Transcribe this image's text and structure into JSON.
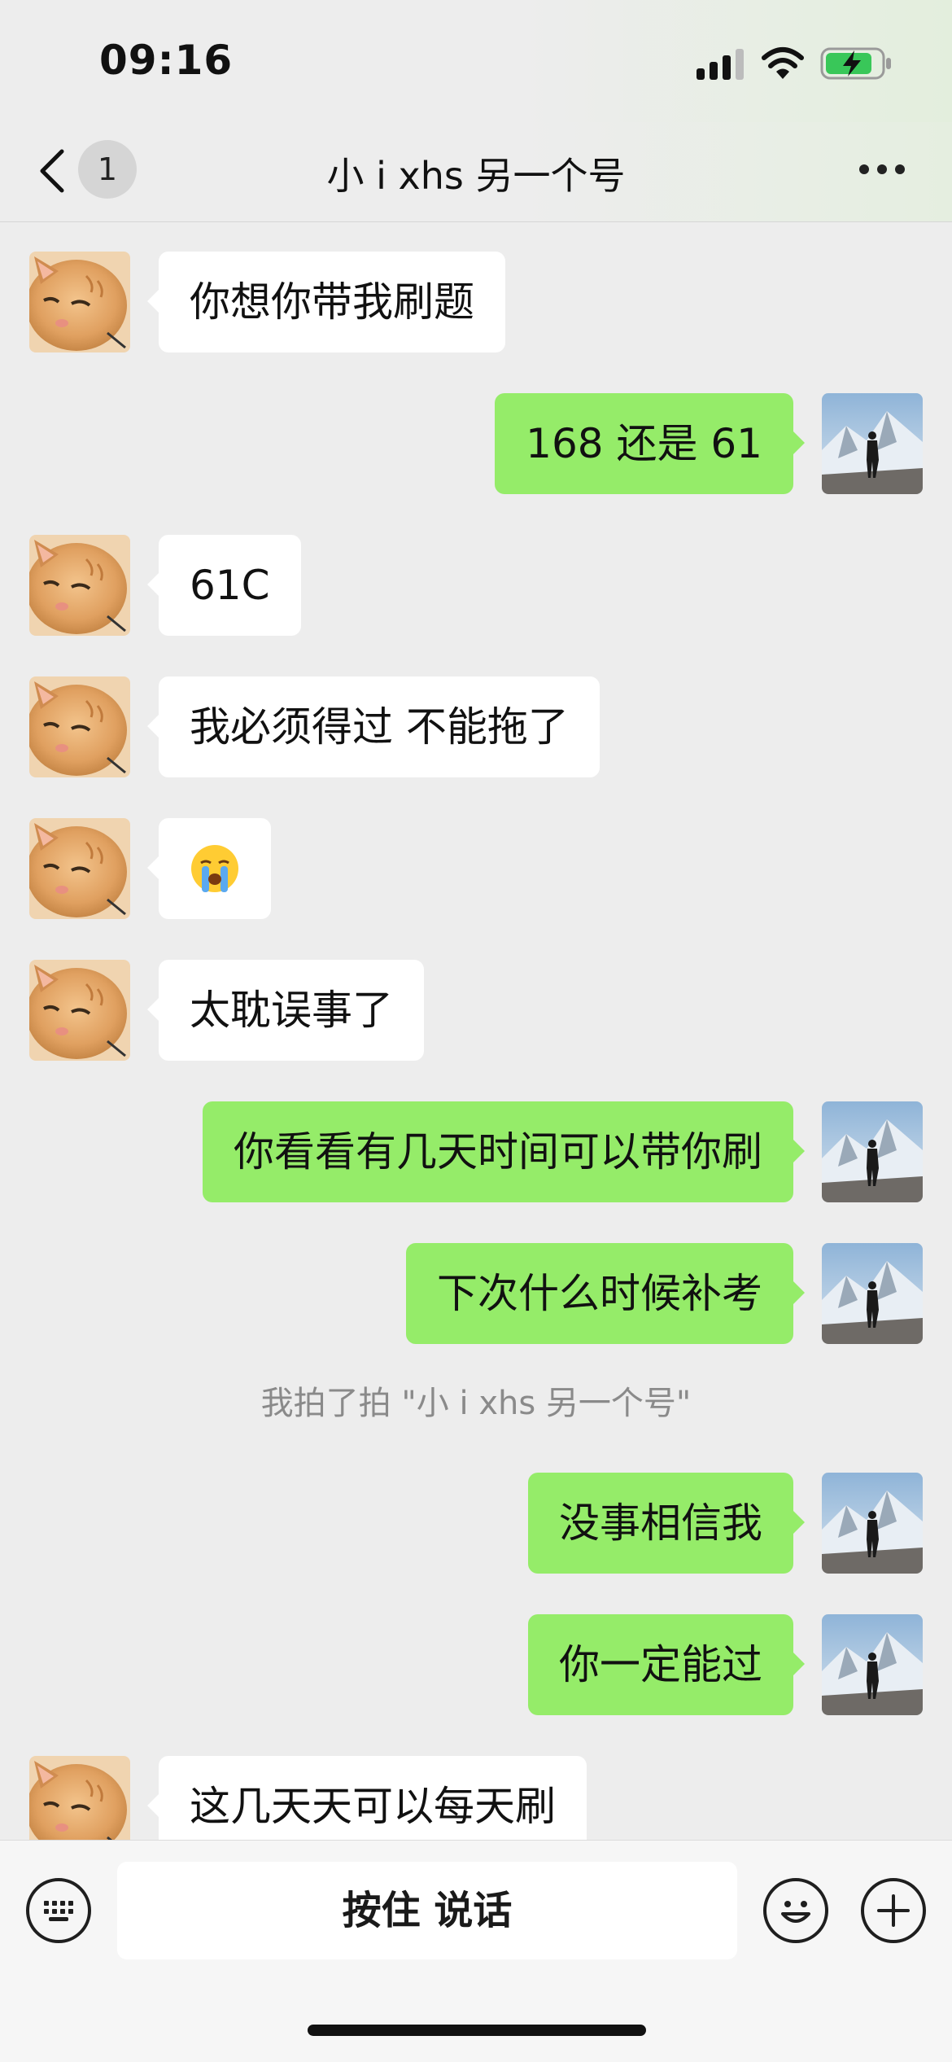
{
  "status_bar": {
    "time": "09:16",
    "battery": "charging"
  },
  "nav": {
    "unread_count": "1",
    "title": "小 i xhs 另一个号",
    "more_icon": "more-icon",
    "back_icon": "back-chevron-icon"
  },
  "messages": [
    {
      "side": "in",
      "text": "你想你带我刷题"
    },
    {
      "side": "out",
      "text": "168 还是 61"
    },
    {
      "side": "in",
      "text": "61C"
    },
    {
      "side": "in",
      "text": "我必须得过 不能拖了"
    },
    {
      "side": "in",
      "emoji": "crying-face"
    },
    {
      "side": "in",
      "text": "太耽误事了"
    },
    {
      "side": "out",
      "text": "你看看有几天时间可以带你刷"
    },
    {
      "side": "out",
      "text": "下次什么时候补考"
    },
    {
      "side": "out",
      "text": "没事相信我"
    },
    {
      "side": "out",
      "text": "你一定能过"
    },
    {
      "side": "in",
      "text": "这几天天可以每天刷"
    }
  ],
  "system_notice": "我拍了拍 \"小 i xhs 另一个号\"",
  "input_bar": {
    "hold_to_talk": "按住 说话",
    "keyboard_icon": "keyboard-icon",
    "emoji_icon": "emoji-icon",
    "plus_icon": "plus-icon"
  },
  "colors": {
    "out_bubble": "#95ec69",
    "in_bubble": "#ffffff",
    "background": "#ededed"
  }
}
